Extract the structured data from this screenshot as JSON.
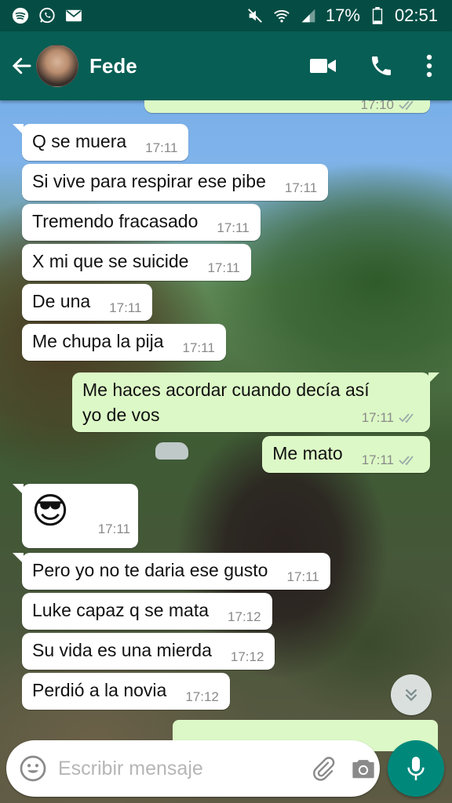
{
  "status_bar": {
    "battery": "17%",
    "time": "02:51",
    "left_icons": [
      "spotify-icon",
      "whatsapp-icon",
      "gmail-icon"
    ],
    "right_icons": [
      "mute-icon",
      "wifi-icon",
      "signal-icon",
      "battery-icon"
    ]
  },
  "header": {
    "contact_name": "Fede",
    "icons": [
      "back-arrow-icon",
      "video-call-icon",
      "phone-call-icon",
      "more-vert-icon"
    ]
  },
  "messages": [
    {
      "id": "m1",
      "direction": "in",
      "text": "Q se muera",
      "time": "17:11"
    },
    {
      "id": "m2",
      "direction": "in",
      "text": "Si vive para respirar ese pibe",
      "time": "17:11"
    },
    {
      "id": "m3",
      "direction": "in",
      "text": "Tremendo fracasado",
      "time": "17:11"
    },
    {
      "id": "m4",
      "direction": "in",
      "text": "X mi que se suicide",
      "time": "17:11"
    },
    {
      "id": "m5",
      "direction": "in",
      "text": "De una",
      "time": "17:11"
    },
    {
      "id": "m6",
      "direction": "in",
      "text": "Me chupa la pija",
      "time": "17:11"
    },
    {
      "id": "m7",
      "direction": "out",
      "text_line1": "Me haces acordar cuando decía así",
      "text_line2": "yo de vos",
      "time": "17:11"
    },
    {
      "id": "m8",
      "direction": "out",
      "text": "Me mato",
      "time": "17:11"
    },
    {
      "id": "m9",
      "direction": "in",
      "text": "😎",
      "time": "17:11"
    },
    {
      "id": "m10",
      "direction": "in",
      "text": "Pero yo no te daria ese gusto",
      "time": "17:11"
    },
    {
      "id": "m11",
      "direction": "in",
      "text": "Luke capaz q se mata",
      "time": "17:12"
    },
    {
      "id": "m12",
      "direction": "in",
      "text": "Su vida es una mierda",
      "time": "17:12"
    },
    {
      "id": "m13",
      "direction": "in",
      "text": "Perdió a la novia",
      "time": "17:12"
    }
  ],
  "partial_top_time": "17:10",
  "composer": {
    "placeholder": "Escribir mensaje",
    "value": ""
  },
  "colors": {
    "status_bar": "#054d44",
    "app_bar": "#075e54",
    "outgoing_bubble": "#dcf8c6",
    "incoming_bubble": "#ffffff",
    "mic_button": "#00897b"
  }
}
